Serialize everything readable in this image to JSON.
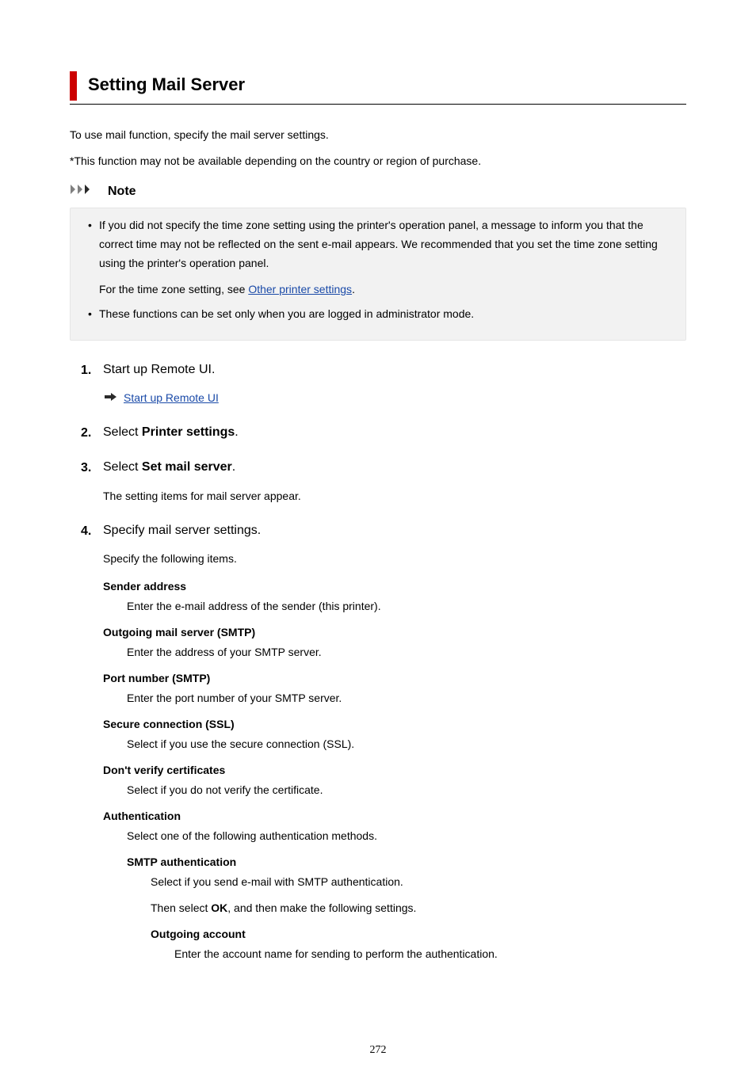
{
  "title": "Setting Mail Server",
  "intro1": "To use mail function, specify the mail server settings.",
  "intro2": "*This function may not be available depending on the country or region of purchase.",
  "note": {
    "label": "Note",
    "item1_a": "If you did not specify the time zone setting using the printer's operation panel, a message to inform you that the correct time may not be reflected on the sent e-mail appears. We recommended that you set the time zone setting using the printer's operation panel.",
    "item1_b_prefix": "For the time zone setting, see ",
    "item1_b_link": "Other printer settings",
    "item1_b_suffix": ".",
    "item2": "These functions can be set only when you are logged in administrator mode."
  },
  "steps": {
    "s1": {
      "text": "Start up Remote UI.",
      "link": "Start up Remote UI"
    },
    "s2": {
      "prefix": "Select ",
      "bold": "Printer settings",
      "suffix": "."
    },
    "s3": {
      "prefix": "Select ",
      "bold": "Set mail server",
      "suffix": ".",
      "body": "The setting items for mail server appear."
    },
    "s4": {
      "text": "Specify mail server settings.",
      "body": "Specify the following items.",
      "defs": {
        "sender": {
          "t": "Sender address",
          "d": "Enter the e-mail address of the sender (this printer)."
        },
        "smtp": {
          "t": "Outgoing mail server (SMTP)",
          "d": "Enter the address of your SMTP server."
        },
        "port": {
          "t": "Port number (SMTP)",
          "d": "Enter the port number of your SMTP server."
        },
        "ssl": {
          "t": "Secure connection (SSL)",
          "d": "Select if you use the secure connection (SSL)."
        },
        "cert": {
          "t": "Don't verify certificates",
          "d": "Select if you do not verify the certificate."
        },
        "auth": {
          "t": "Authentication",
          "d": "Select one of the following authentication methods.",
          "smtp_auth": {
            "t": "SMTP authentication",
            "d1": "Select if you send e-mail with SMTP authentication.",
            "d2_a": "Then select ",
            "d2_b": "OK",
            "d2_c": ", and then make the following settings.",
            "outacc": {
              "t": "Outgoing account",
              "d": "Enter the account name for sending to perform the authentication."
            }
          }
        }
      }
    }
  },
  "page": "272"
}
